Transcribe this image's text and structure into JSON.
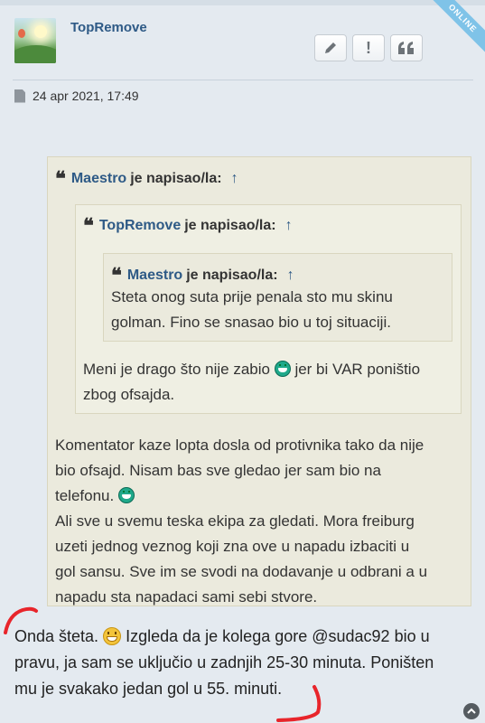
{
  "post": {
    "author": "TopRemove",
    "status_badge": "ONLINE",
    "date": "24 apr 2021, 17:49",
    "actions": [
      {
        "name": "edit",
        "icon": "pencil-icon"
      },
      {
        "name": "report",
        "glyph": "!",
        "icon": "exclamation-icon"
      },
      {
        "name": "quote",
        "icon": "quote-icon"
      }
    ]
  },
  "quote_outer": {
    "author": "Maestro",
    "wrote": "je napisao/la:",
    "arrow": "↑",
    "lines": [
      "Komentator kaze lopta dosla od protivnika tako da nije",
      "bio ofsajd. Nisam bas sve gledao jer sam bio na",
      "telefonu.",
      "Ali sve u svemu teska ekipa za gledati. Mora freiburg",
      "uzeti jednog veznog koji zna ove u napadu izbaciti u",
      "gol sansu. Sve im se svodi na dodavanje u odbrani a u",
      "napadu sta napadaci sami sebi stvore."
    ]
  },
  "quote_middle": {
    "author": "TopRemove",
    "wrote": "je napisao/la:",
    "arrow": "↑",
    "line1_before": "Meni je drago što nije zabio",
    "line1_after": "jer bi VAR poništio",
    "line2": "zbog ofsajda."
  },
  "quote_inner": {
    "author": "Maestro",
    "wrote": "je napisao/la:",
    "arrow": "↑",
    "lines": [
      "Steta onog suta prije penala sto mu skinu",
      "golman. Fino se snasao bio u toj situaciji."
    ]
  },
  "reply": {
    "line1_before": "Onda šteta.",
    "line1_after": "Izgleda da je kolega gore @sudac92 bio u",
    "line2": "pravu, ja sam se uključio u zadnjih 25-30 minuta. Poništen",
    "line3": "mu je svakako jedan gol u 55. minuti."
  },
  "colors": {
    "username": "#2e5a86",
    "quote_bg": "#ebeadd",
    "annotation": "#e8252b",
    "online_ribbon": "#7fc3e8"
  }
}
